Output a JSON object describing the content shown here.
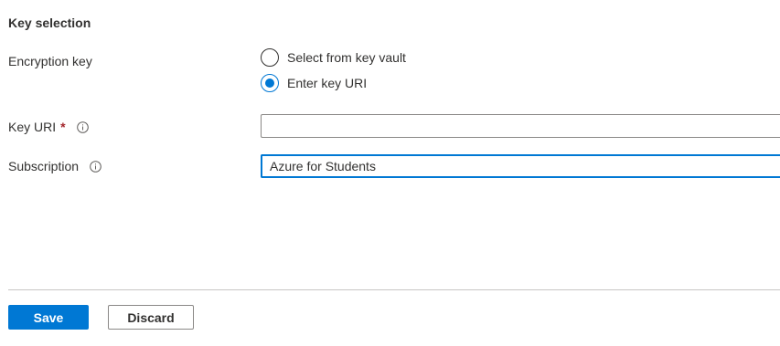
{
  "section": {
    "title": "Key selection"
  },
  "encryption_key": {
    "label": "Encryption key",
    "options": [
      {
        "label": "Select from key vault",
        "checked": false
      },
      {
        "label": "Enter key URI",
        "checked": true
      }
    ]
  },
  "key_uri": {
    "label": "Key URI",
    "required_marker": "*",
    "info_icon": "info-icon",
    "value": ""
  },
  "subscription": {
    "label": "Subscription",
    "info_icon": "info-icon",
    "value": "Azure for Students"
  },
  "footer": {
    "save_label": "Save",
    "discard_label": "Discard"
  },
  "colors": {
    "accent": "#0078d4",
    "text": "#323130",
    "required": "#a4262c",
    "border": "#8a8886"
  }
}
